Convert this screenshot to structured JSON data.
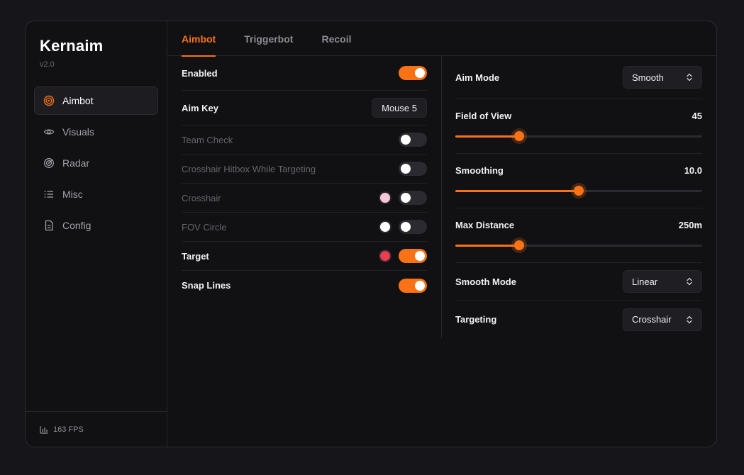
{
  "app": {
    "name": "Kernaim",
    "version": "v2.0"
  },
  "sidebar": {
    "items": [
      {
        "label": "Aimbot",
        "icon": "target-icon",
        "active": true
      },
      {
        "label": "Visuals",
        "icon": "eye-icon",
        "active": false
      },
      {
        "label": "Radar",
        "icon": "radar-icon",
        "active": false
      },
      {
        "label": "Misc",
        "icon": "list-icon",
        "active": false
      },
      {
        "label": "Config",
        "icon": "file-icon",
        "active": false
      }
    ],
    "fps": "163 FPS"
  },
  "tabs": [
    {
      "label": "Aimbot",
      "active": true
    },
    {
      "label": "Triggerbot",
      "active": false
    },
    {
      "label": "Recoil",
      "active": false
    }
  ],
  "left": {
    "enabled": {
      "label": "Enabled",
      "on": true
    },
    "aim_key": {
      "label": "Aim Key",
      "value": "Mouse 5"
    },
    "team_check": {
      "label": "Team Check",
      "on": false
    },
    "crosshair_hitbox": {
      "label": "Crosshair Hitbox While Targeting",
      "on": false
    },
    "crosshair": {
      "label": "Crosshair",
      "color": "#f9c6d6",
      "on": false
    },
    "fov_circle": {
      "label": "FOV Circle",
      "color": "#ffffff",
      "on": false
    },
    "target": {
      "label": "Target",
      "color": "#ef3b4f",
      "on": true
    },
    "snap_lines": {
      "label": "Snap Lines",
      "on": true
    }
  },
  "right": {
    "aim_mode": {
      "label": "Aim Mode",
      "value": "Smooth"
    },
    "fov": {
      "label": "Field of View",
      "value": "45",
      "fraction": 0.26
    },
    "smoothing": {
      "label": "Smoothing",
      "value": "10.0",
      "fraction": 0.5
    },
    "max_distance": {
      "label": "Max Distance",
      "value": "250m",
      "fraction": 0.26
    },
    "smooth_mode": {
      "label": "Smooth Mode",
      "value": "Linear"
    },
    "targeting": {
      "label": "Targeting",
      "value": "Crosshair"
    }
  },
  "colors": {
    "accent": "#f97316",
    "background": "#111114",
    "surface": "#1e1e23"
  }
}
